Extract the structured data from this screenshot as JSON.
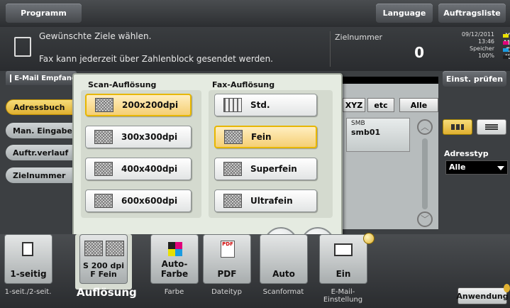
{
  "topbar": {
    "program_label": "Programm",
    "language_label": "Language",
    "joblist_label": "Auftragsliste"
  },
  "message": {
    "line1": "Gewünschte Ziele wählen.",
    "line2": "Fax kann jederzeit über Zahlenblock gesendet werden.",
    "dest_number_label": "Zielnummer",
    "dest_count": "0"
  },
  "status": {
    "date": "09/12/2011",
    "time": "13:46",
    "memory_label": "Speicher",
    "memory_value": "100%",
    "toner": [
      {
        "letter": "Y",
        "color": "#e8e000"
      },
      {
        "letter": "M",
        "color": "#e0007a"
      },
      {
        "letter": "C",
        "color": "#1a9be0"
      },
      {
        "letter": "K",
        "color": "#202020"
      }
    ]
  },
  "email_tab_label": "E-Mail Empfang",
  "check_settings_label": "Einst. prüfen",
  "side_nav": [
    "Adressbuch",
    "Man. Eingabe",
    "Auftr.verlauf",
    "Zielnummer"
  ],
  "filter_tabs": {
    "xyz": "XYZ",
    "etc": "etc",
    "all": "Alle"
  },
  "address_entry": {
    "type": "SMB",
    "name": "smb01"
  },
  "address_type": {
    "label": "Adresstyp",
    "value": "Alle"
  },
  "dialog": {
    "scan_title": "Scan-Auflösung",
    "fax_title": "Fax-Auflösung",
    "scan_options": [
      "200x200dpi",
      "300x300dpi",
      "400x400dpi",
      "600x600dpi"
    ],
    "scan_selected": "200x200dpi",
    "fax_options": [
      "Std.",
      "Fein",
      "Superfein",
      "Ultrafein"
    ],
    "fax_selected": "Fein",
    "cancel_symbol": "✕",
    "ok_symbol": "✔"
  },
  "bottom_buttons": [
    {
      "label": "1-seitig",
      "caption": "1-seit./2-seit."
    },
    {
      "label": "S 200 dpi\nF Fein",
      "caption": "Auflösung"
    },
    {
      "label": "Auto-Farbe",
      "caption": "Farbe"
    },
    {
      "label": "PDF",
      "caption": "Dateityp"
    },
    {
      "label": "Auto",
      "caption": "Scanformat"
    },
    {
      "label": "Ein",
      "caption": "E-Mail-\nEinstellung"
    }
  ],
  "application_label": "Anwendung"
}
